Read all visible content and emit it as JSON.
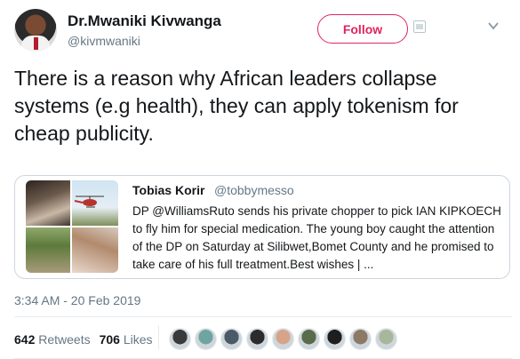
{
  "author": {
    "display_name": "Dr.Mwaniki Kivwanga",
    "handle": "@kivmwaniki"
  },
  "actions": {
    "follow_label": "Follow"
  },
  "tweet": {
    "text": "There is a reason why African leaders collapse systems (e.g health), they can apply tokenism for cheap publicity.",
    "timestamp": "3:34 AM - 20 Feb 2019"
  },
  "quoted_tweet": {
    "display_name": "Tobias Korir",
    "handle": "@tobbymesso",
    "text": "DP @WilliamsRuto sends his private chopper to pick IAN KIPKOECH to fly him for special medication. The young boy caught the attention of the DP on Saturday at Silibwet,Bomet County and he promised to take care of his full treatment.Best wishes | ..."
  },
  "stats": {
    "retweets_count": "642",
    "retweets_label": "Retweets",
    "likes_count": "706",
    "likes_label": "Likes"
  },
  "likers": [
    "#3a3a3a",
    "#6fa5a0",
    "#4b5a68",
    "#2c2c2c",
    "#d7a48a",
    "#5a6b4b",
    "#1e1e1e",
    "#8d7a66",
    "#a8b79a"
  ],
  "colors": {
    "accent": "#e0245e",
    "muted_text": "#657786",
    "border": "#ccd6dd"
  }
}
